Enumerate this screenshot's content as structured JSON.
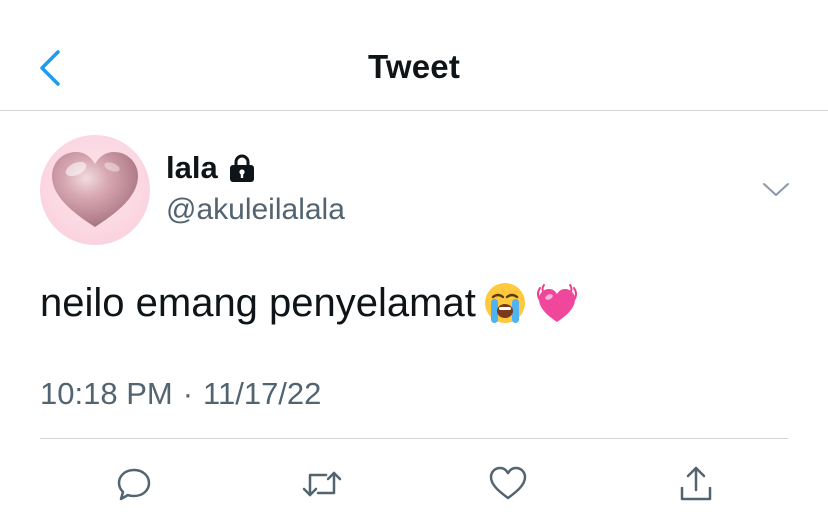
{
  "header": {
    "title": "Tweet",
    "back_icon": "chevron-left-icon"
  },
  "tweet": {
    "author": {
      "display_name": "lala",
      "handle": "@akuleilalala",
      "protected_icon": "lock-icon",
      "avatar": "pink-heart-avatar"
    },
    "text": "neilo emang penyelamat",
    "emojis": [
      "loudly-crying-face-emoji",
      "beating-heart-emoji"
    ],
    "time": "10:18 PM",
    "separator": "·",
    "date": "11/17/22"
  },
  "actions": [
    {
      "name": "reply",
      "icon": "reply-icon"
    },
    {
      "name": "retweet",
      "icon": "retweet-icon"
    },
    {
      "name": "like",
      "icon": "heart-icon"
    },
    {
      "name": "share",
      "icon": "share-icon"
    }
  ],
  "colors": {
    "accent": "#1d9bf0",
    "text": "#0f1419",
    "secondary": "#536471",
    "divider": "#d6d6d6"
  }
}
